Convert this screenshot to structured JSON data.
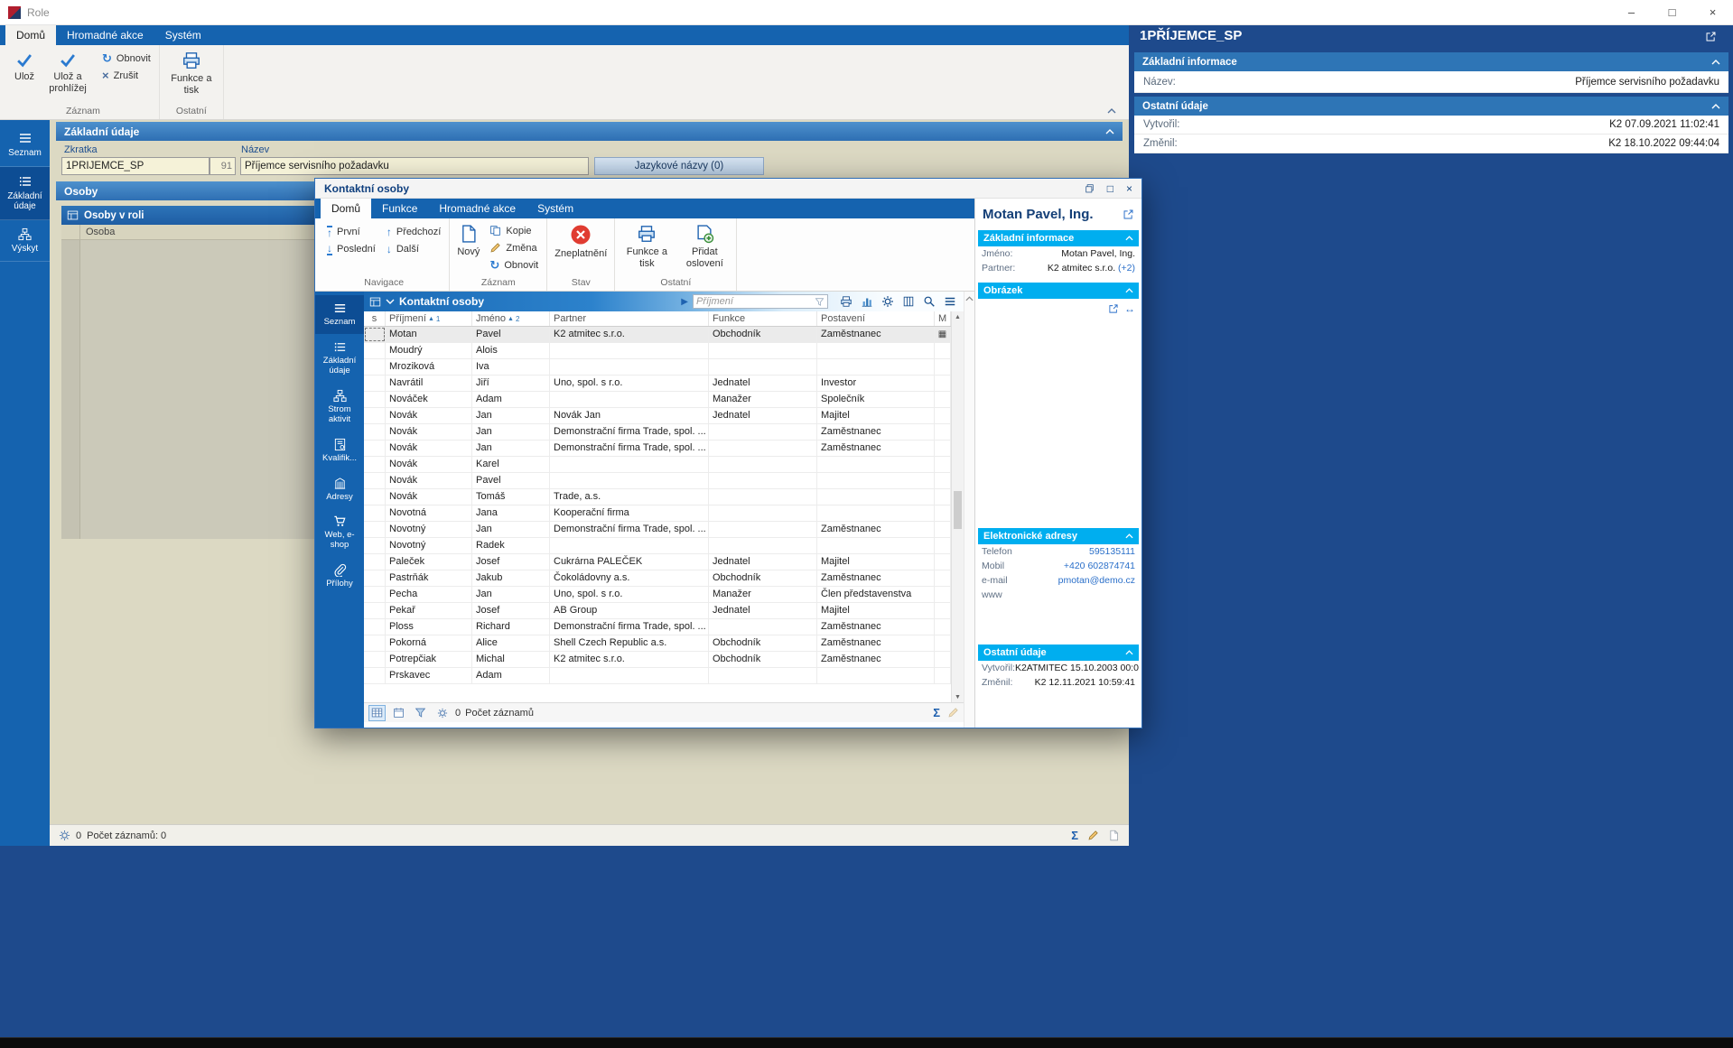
{
  "icons": {
    "check": "✓",
    "refresh": "↻",
    "close": "×",
    "minimize": "–",
    "maximize": "□",
    "arrow_up": "↑",
    "arrow_down": "↓",
    "play": "▶",
    "sum": "Σ",
    "hresize": "↔",
    "sort_asc": "▲"
  },
  "window": {
    "title": "Role"
  },
  "main": {
    "tabs": [
      {
        "label": "Domů"
      },
      {
        "label": "Hromadné akce"
      },
      {
        "label": "Systém"
      }
    ],
    "ribbon": {
      "save": "Ulož",
      "save_and_view": "Ulož a prohlížej",
      "refresh": "Obnovit",
      "cancel": "Zrušit",
      "functions_print": "Funkce a tisk",
      "group_record": "Záznam",
      "group_other": "Ostatní"
    },
    "sidebar": [
      {
        "label": "Seznam"
      },
      {
        "label": "Základní údaje"
      },
      {
        "label": "Výskyt"
      }
    ],
    "form": {
      "section_basic": "Základní údaje",
      "shortcut_label": "Zkratka",
      "shortcut_value": "1PŘÍJEMCE_SP",
      "shortcut_number": "91",
      "name_label": "Název",
      "name_value": "Příjemce servisního požadavku",
      "language_names_button": "Jazykové názvy (0)",
      "section_persons": "Osoby",
      "persons_grid_title": "Osoby v roli",
      "persons_column": "Osoba"
    },
    "statusbar": {
      "counter": "0",
      "records": "Počet záznamů: 0"
    },
    "right_panel": {
      "title": "1PŘÍJEMCE_SP",
      "basic_header": "Základní informace",
      "name_label": "Název:",
      "name_value": "Příjemce servisního požadavku",
      "other_header": "Ostatní údaje",
      "created_label": "Vytvořil:",
      "created_value": "K2 07.09.2021 11:02:41",
      "modified_label": "Změnil:",
      "modified_value": "K2 18.10.2022 09:44:04"
    }
  },
  "modal": {
    "title": "Kontaktní osoby",
    "tabs": [
      {
        "label": "Domů"
      },
      {
        "label": "Funkce"
      },
      {
        "label": "Hromadné akce"
      },
      {
        "label": "Systém"
      }
    ],
    "ribbon": {
      "first": "První",
      "last": "Poslední",
      "previous": "Předchozí",
      "next": "Další",
      "new": "Nový",
      "copy": "Kopie",
      "change": "Změna",
      "refresh": "Obnovit",
      "invalidate": "Zneplatnění",
      "functions_print": "Funkce a tisk",
      "add_salutation": "Přidat oslovení",
      "group_navigation": "Navigace",
      "group_record": "Záznam",
      "group_state": "Stav",
      "group_other": "Ostatní"
    },
    "sidebar": [
      {
        "label": "Seznam"
      },
      {
        "label": "Základní údaje"
      },
      {
        "label": "Strom aktivit"
      },
      {
        "label": "Kvalifik..."
      },
      {
        "label": "Adresy"
      },
      {
        "label": "Web, e-shop"
      },
      {
        "label": "Přílohy"
      }
    ],
    "table": {
      "title": "Kontaktní osoby",
      "search_placeholder": "Příjmení",
      "columns": [
        {
          "label": "s"
        },
        {
          "label": "Příjmení",
          "sort": "1"
        },
        {
          "label": "Jméno",
          "sort": "2"
        },
        {
          "label": "Partner"
        },
        {
          "label": "Funkce"
        },
        {
          "label": "Postavení"
        },
        {
          "label": "M"
        }
      ],
      "rows": [
        {
          "surname": "Motan",
          "first_name": "Pavel",
          "partner": "K2 atmitec s.r.o.",
          "function": "Obchodník",
          "position": "Zaměstnanec",
          "m": "▦"
        },
        {
          "surname": "Moudrý",
          "first_name": "Alois",
          "partner": "",
          "function": "",
          "position": "",
          "m": ""
        },
        {
          "surname": "Mroziková",
          "first_name": "Iva",
          "partner": "",
          "function": "",
          "position": "",
          "m": ""
        },
        {
          "surname": "Navrátil",
          "first_name": "Jiří",
          "partner": "Uno, spol. s r.o.",
          "function": "Jednatel",
          "position": "Investor",
          "m": ""
        },
        {
          "surname": "Nováček",
          "first_name": "Adam",
          "partner": "",
          "function": "Manažer",
          "position": "Společník",
          "m": ""
        },
        {
          "surname": "Novák",
          "first_name": "Jan",
          "partner": "Novák Jan",
          "function": "Jednatel",
          "position": "Majitel",
          "m": ""
        },
        {
          "surname": "Novák",
          "first_name": "Jan",
          "partner": "Demonstrační firma Trade, spol. ...",
          "function": "",
          "position": "Zaměstnanec",
          "m": ""
        },
        {
          "surname": "Novák",
          "first_name": "Jan",
          "partner": "Demonstrační firma Trade, spol. ...",
          "function": "",
          "position": "Zaměstnanec",
          "m": ""
        },
        {
          "surname": "Novák",
          "first_name": "Karel",
          "partner": "",
          "function": "",
          "position": "",
          "m": ""
        },
        {
          "surname": "Novák",
          "first_name": "Pavel",
          "partner": "",
          "function": "",
          "position": "",
          "m": ""
        },
        {
          "surname": "Novák",
          "first_name": "Tomáš",
          "partner": "Trade, a.s.",
          "function": "",
          "position": "",
          "m": ""
        },
        {
          "surname": "Novotná",
          "first_name": "Jana",
          "partner": "Kooperační firma",
          "function": "",
          "position": "",
          "m": ""
        },
        {
          "surname": "Novotný",
          "first_name": "Jan",
          "partner": "Demonstrační firma Trade, spol. ...",
          "function": "",
          "position": "Zaměstnanec",
          "m": ""
        },
        {
          "surname": "Novotný",
          "first_name": "Radek",
          "partner": "",
          "function": "",
          "position": "",
          "m": ""
        },
        {
          "surname": "Paleček",
          "first_name": "Josef",
          "partner": "Cukrárna PALEČEK",
          "function": "Jednatel",
          "position": "Majitel",
          "m": ""
        },
        {
          "surname": "Pastrňák",
          "first_name": "Jakub",
          "partner": "Čokoládovny a.s.",
          "function": "Obchodník",
          "position": "Zaměstnanec",
          "m": ""
        },
        {
          "surname": "Pecha",
          "first_name": "Jan",
          "partner": "Uno, spol. s r.o.",
          "function": "Manažer",
          "position": "Člen představenstva",
          "m": ""
        },
        {
          "surname": "Pekař",
          "first_name": "Josef",
          "partner": "AB Group",
          "function": "Jednatel",
          "position": "Majitel",
          "m": ""
        },
        {
          "surname": "Ploss",
          "first_name": "Richard",
          "partner": "Demonstrační firma Trade, spol. ...",
          "function": "",
          "position": "Zaměstnanec",
          "m": ""
        },
        {
          "surname": "Pokorná",
          "first_name": "Alice",
          "partner": "Shell Czech Republic a.s.",
          "function": "Obchodník",
          "position": "Zaměstnanec",
          "m": ""
        },
        {
          "surname": "Potrepčiak",
          "first_name": "Michal",
          "partner": "K2 atmitec s.r.o.",
          "function": "Obchodník",
          "position": "Zaměstnanec",
          "m": ""
        },
        {
          "surname": "Prskavec",
          "first_name": "Adam",
          "partner": "",
          "function": "",
          "position": "",
          "m": ""
        }
      ],
      "statusbar": {
        "counter": "0",
        "records": "Počet záznamů"
      }
    },
    "right_panel": {
      "title": "Motan Pavel, Ing.",
      "basic_header": "Základní informace",
      "name_label": "Jméno:",
      "name_value": "Motan Pavel, Ing.",
      "partner_label": "Partner:",
      "partner_value": "K2 atmitec s.r.o.",
      "partner_more": "(+2)",
      "image_header": "Obrázek",
      "addresses_header": "Elektronické adresy",
      "addresses": [
        {
          "label": "Telefon",
          "value": "595135111"
        },
        {
          "label": "Mobil",
          "value": "+420 602874741"
        },
        {
          "label": "e-mail",
          "value": "pmotan@demo.cz"
        },
        {
          "label": "www",
          "value": ""
        }
      ],
      "other_header": "Ostatní údaje",
      "created_label": "Vytvořil:",
      "created_value": "K2ATMITEC 15.10.2003 00:0...",
      "modified_label": "Změnil:",
      "modified_value": "K2 12.11.2021 10:59:41"
    }
  }
}
